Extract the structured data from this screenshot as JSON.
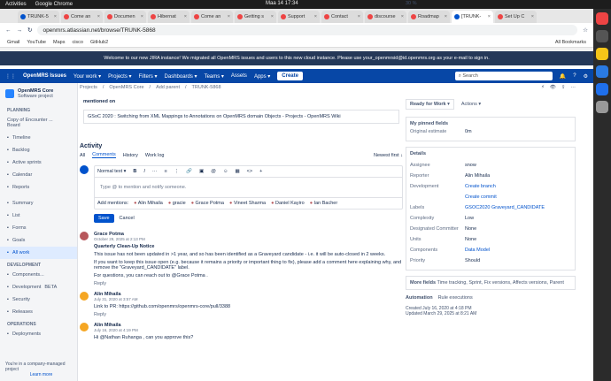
{
  "system": {
    "activities": "Activities",
    "app": "Google Chrome",
    "clock": "Maa 14  17:34",
    "battery": "30 %"
  },
  "tabs": [
    {
      "label": "TRUNK-5",
      "color": "#0052cc"
    },
    {
      "label": "Come an",
      "color": "#e44"
    },
    {
      "label": "Documen",
      "color": "#e44"
    },
    {
      "label": "Hibernat",
      "color": "#e44"
    },
    {
      "label": "Come an",
      "color": "#e44"
    },
    {
      "label": "Getting s",
      "color": "#e44"
    },
    {
      "label": "Support",
      "color": "#e44"
    },
    {
      "label": "Contact",
      "color": "#e44"
    },
    {
      "label": "discourse",
      "color": "#e44"
    },
    {
      "label": "Roadmap",
      "color": "#e44"
    },
    {
      "label": "[TRUNK-",
      "color": "#0052cc",
      "active": true
    },
    {
      "label": "Set Up C",
      "color": "#e44"
    }
  ],
  "browser": {
    "url": "openmrs.atlassian.net/browse/TRUNK-5868",
    "bookmarks": [
      "Gmail",
      "YouTube",
      "Maps",
      "cisco",
      "GitHub2"
    ],
    "all_bookmarks": "All Bookmarks"
  },
  "banner": "Welcome to our new JIRA instance! We migrated all OpenMRS issues and users to this new cloud instance. Please use your_openmrsid@id.openmrs.org as your e-mail to sign in.",
  "jira_nav": {
    "brand": "OpenMRS Issues",
    "items": [
      "Your work ▾",
      "Projects ▾",
      "Filters ▾",
      "Dashboards ▾",
      "Teams ▾",
      "Assets",
      "Apps ▾"
    ],
    "create": "Create",
    "search": "Search"
  },
  "sidebar": {
    "project": "OpenMRS Core",
    "project_type": "Software project",
    "planning": "PLANNING",
    "board": "Copy of Encounter ...",
    "board_sub": "Board",
    "planning_items": [
      "Timeline",
      "Backlog",
      "Active sprints",
      "Calendar",
      "Reports"
    ],
    "items": [
      "Summary",
      "List",
      "Forms",
      "Goals",
      "All work"
    ],
    "development": "DEVELOPMENT",
    "dev_items": [
      "Components...",
      "Development",
      "Security",
      "Releases"
    ],
    "beta": "BETA",
    "operations": "OPERATIONS",
    "ops_items": [
      "Deployments"
    ],
    "footer": "You're in a company-managed project",
    "learn": "Learn more"
  },
  "breadcrumb": [
    "Projects",
    "OpenMRS Core",
    "Add parent",
    "TRUNK-5868"
  ],
  "mentioned": {
    "label": "mentioned on",
    "text": "GSoC 2020 : Switching from XML Mappings to Annotations on OpenMRS domain Objects - Projects - OpenMRS Wiki"
  },
  "activity": {
    "title": "Activity",
    "tabs": [
      "All",
      "Comments",
      "History",
      "Work log"
    ],
    "sort": "Newest first ↓",
    "format": "Normal text ▾",
    "placeholder": "Type @ to mention and notify someone.",
    "add_mentions": "Add mentions:",
    "mentions": [
      "Alin Mihaila",
      "gracie",
      "Grace Potma",
      "Vineet Sharma",
      "Daniel Kayiro",
      "Ian Bacher"
    ],
    "save": "Save",
    "cancel": "Cancel"
  },
  "comments": [
    {
      "author": "Grace Potma",
      "date": "October 29, 2025 at 2:13 PM",
      "title": "Quarterly Clean-Up Notice",
      "paras": [
        "This issue has not been updated in >1 year, and so has been identified as a Graveyard candidate - i.e. it will be auto-closed in 2 weeks.",
        "If you want to keep this issue open (e.g. because it remains a priority or important thing to fix), please add a comment here explaining why, and remove the \"Graveyard_CANDIDATE\" label.",
        "For questions, you can reach out to  @Grace Potma ."
      ],
      "reply": "Reply",
      "color": "#b7575c"
    },
    {
      "author": "Alin Mihaila",
      "date": "July 31, 2020 at 3:57 AM",
      "paras": [
        "Link to PR: https://github.com/openmrs/openmrs-core/pull/3388"
      ],
      "reply": "Reply",
      "color": "#f5a623"
    },
    {
      "author": "Alin Mihaila",
      "date": "July 16, 2020 at 4:19 PM",
      "paras": [
        "Hi  @Nathan Ruhanga , can you approve this?"
      ],
      "reply": "",
      "color": "#f5a623"
    }
  ],
  "details": {
    "status": "Ready for Work ▾",
    "actions": "Actions ▾",
    "pinned": "My pinned fields",
    "orig_est_k": "Original estimate",
    "orig_est_v": "0m",
    "title": "Details",
    "fields": [
      {
        "k": "Assignee",
        "v": "snow"
      },
      {
        "k": "Reporter",
        "v": "Alin Mihaila"
      },
      {
        "k": "Development",
        "v": "Create branch"
      },
      {
        "k": "",
        "v": "Create commit"
      },
      {
        "k": "Labels",
        "v": "GSOC2020   Graveyard_CANDIDATE"
      },
      {
        "k": "Complexity",
        "v": "Low"
      },
      {
        "k": "Designated Committer",
        "v": "None"
      },
      {
        "k": "Units",
        "v": "None"
      },
      {
        "k": "Components",
        "v": "Data Model"
      },
      {
        "k": "Priority",
        "v": "Should"
      }
    ],
    "more": "More fields",
    "more_sub": "Time tracking, Sprint, Fix versions, Affects versions, Parent",
    "automation": "Automation",
    "rule": "Rule executions",
    "created": "Created July 16, 2020 at 4:18 PM",
    "updated": "Updated March 29, 2025 at 8:21 AM"
  }
}
